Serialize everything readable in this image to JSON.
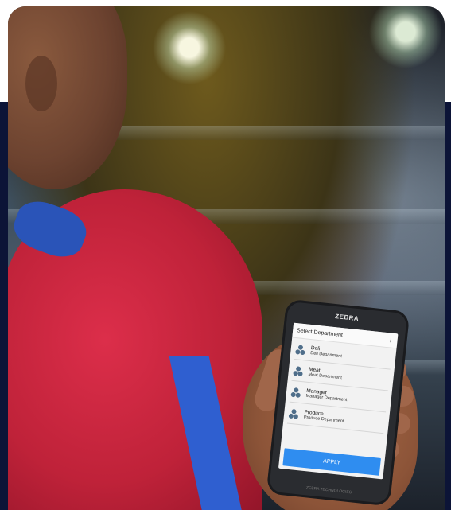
{
  "device": {
    "brand_logo": "ZEBRA",
    "bottom_brand": "ZEBRA TECHNOLOGIES"
  },
  "app": {
    "header_title": "Select Department",
    "menu_icon": "more-vert-icon",
    "departments": [
      {
        "name": "Deli",
        "subtitle": "Deli Department",
        "icon": "department-icon"
      },
      {
        "name": "Meat",
        "subtitle": "Meat Department",
        "icon": "department-icon"
      },
      {
        "name": "Manager",
        "subtitle": "Manager Department",
        "icon": "department-icon"
      },
      {
        "name": "Produce",
        "subtitle": "Produce Department",
        "icon": "department-icon"
      }
    ],
    "apply_label": "APPLY"
  },
  "colors": {
    "background_navy": "#0c1437",
    "apply_button": "#2f8df0",
    "shirt_red": "#c8243c"
  }
}
